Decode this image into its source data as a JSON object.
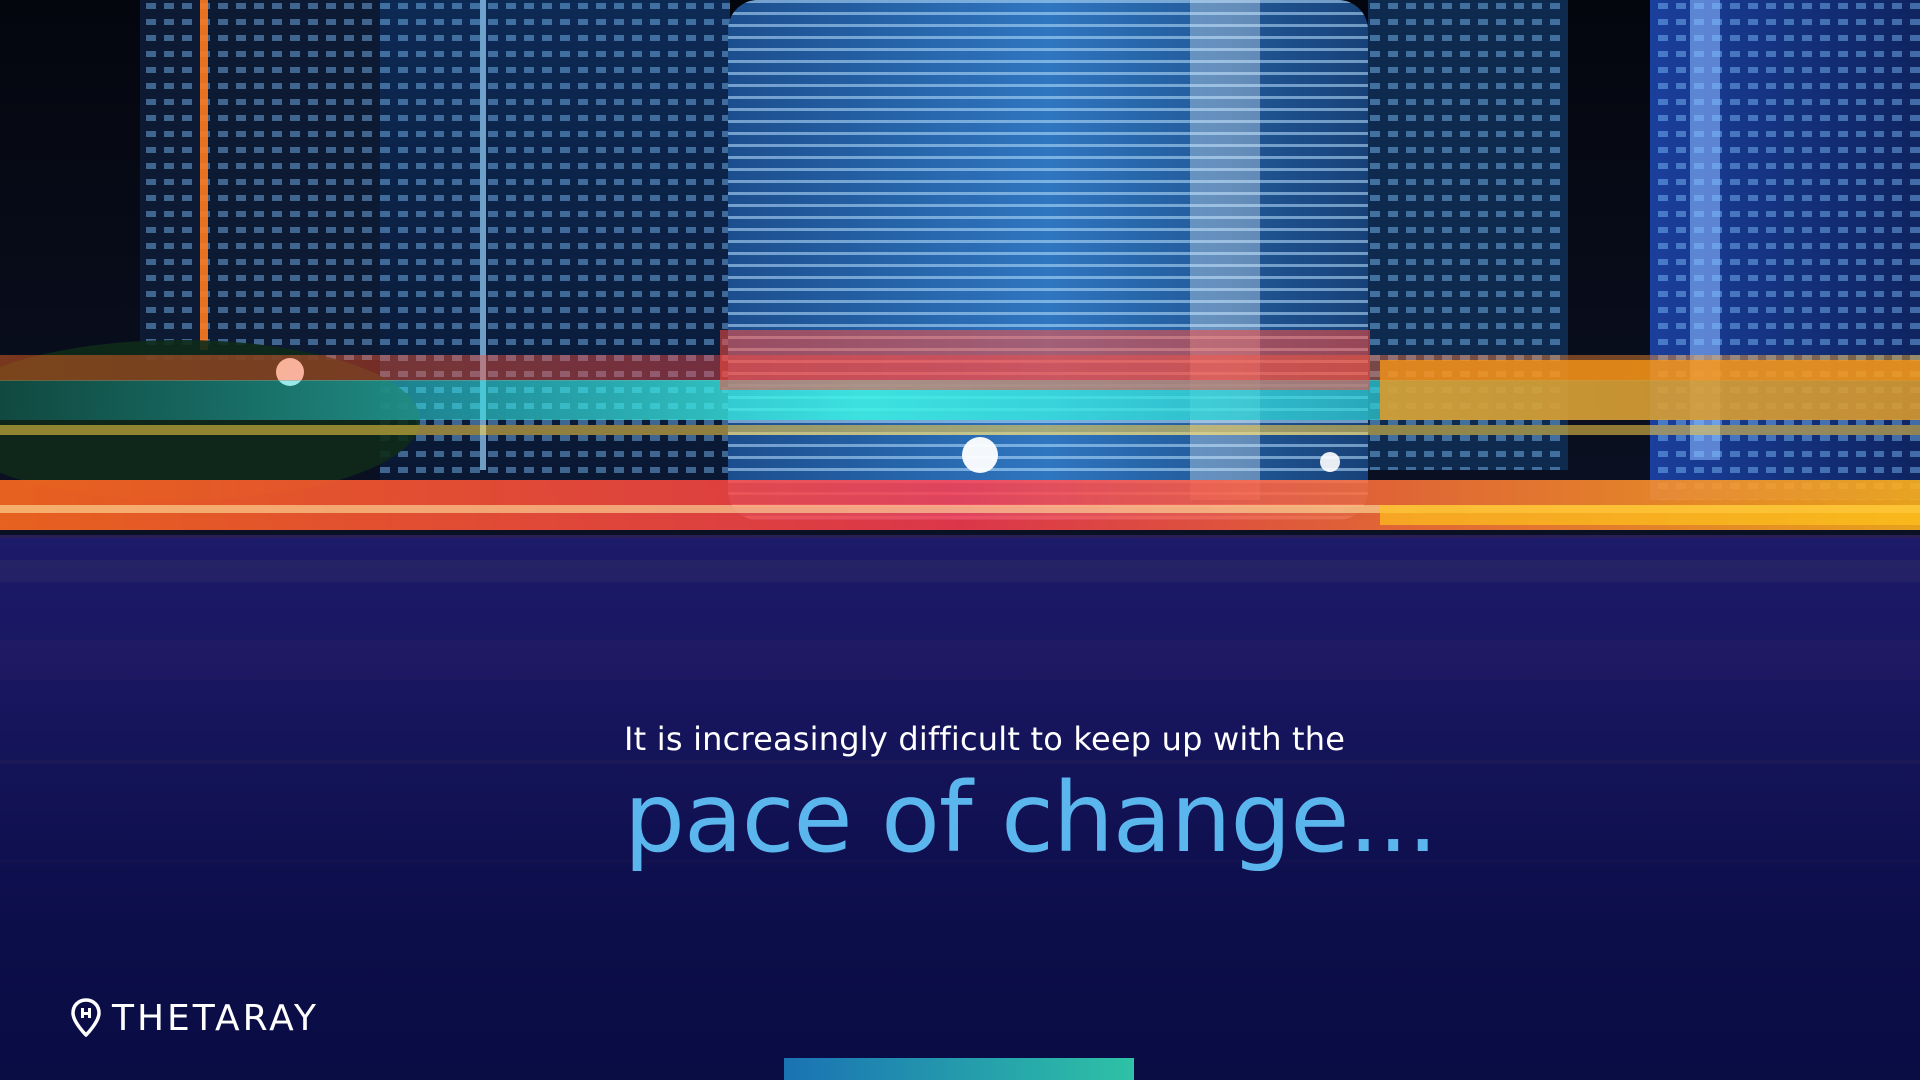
{
  "slide": {
    "subtitle": "It is increasingly difficult to keep up with the",
    "headline": "pace of change...",
    "brand": {
      "name": "THETARAY",
      "icon": "location-pin-icon"
    },
    "colors": {
      "background": "#0b0d47",
      "headline": "#5cb6ee",
      "subtitle": "#ffffff",
      "accent_start": "#1a72b3",
      "accent_end": "#2ec2a6"
    }
  }
}
